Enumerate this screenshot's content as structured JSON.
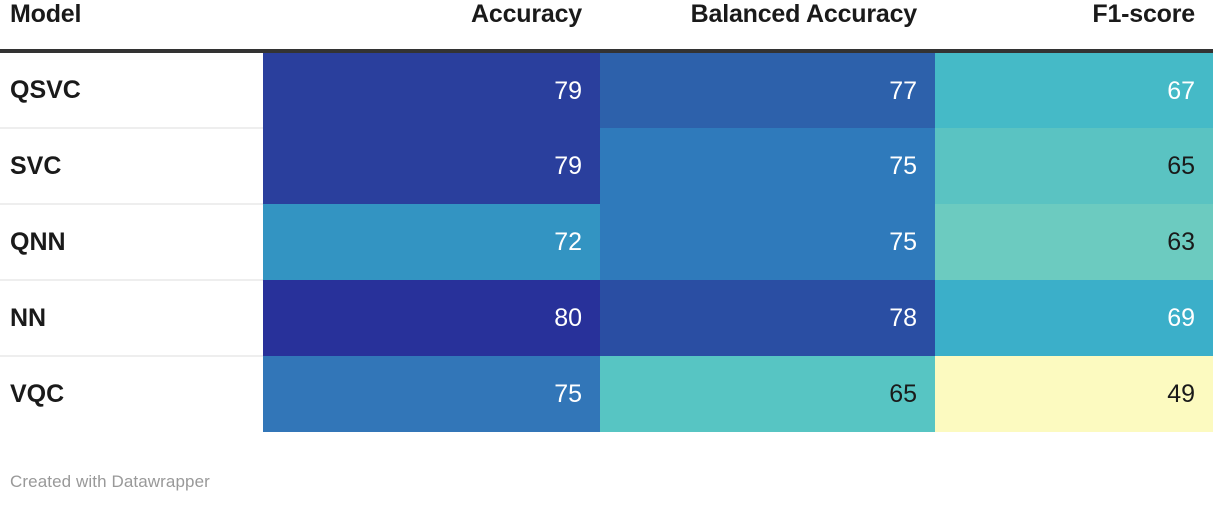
{
  "footer": {
    "credit": "Created with Datawrapper"
  },
  "chart_data": {
    "type": "heatmap",
    "title": "",
    "subtitle": "",
    "xlabel": "",
    "ylabel": "",
    "grid": false,
    "legend": "none",
    "value_suffix": "",
    "columns": [
      "Model",
      "Accuracy",
      "Balanced Accuracy",
      "F1-score"
    ],
    "row_label_header": "Model",
    "categories": [
      "QSVC",
      "SVC",
      "QNN",
      "NN",
      "VQC"
    ],
    "series": [
      {
        "name": "Accuracy",
        "values": [
          79,
          79,
          72,
          80,
          75
        ]
      },
      {
        "name": "Balanced Accuracy",
        "values": [
          77,
          75,
          75,
          78,
          65
        ]
      },
      {
        "name": "F1-score",
        "values": [
          67,
          65,
          63,
          69,
          49
        ]
      }
    ],
    "rows": [
      {
        "model": "QSVC",
        "cells": [
          {
            "column": "Accuracy",
            "value": 79,
            "bg": "#2a3f9d",
            "fg": "#ffffff"
          },
          {
            "column": "Balanced Accuracy",
            "value": 77,
            "bg": "#2d61ab",
            "fg": "#ffffff"
          },
          {
            "column": "F1-score",
            "value": 67,
            "bg": "#45bac7",
            "fg": "#ffffff"
          }
        ]
      },
      {
        "model": "SVC",
        "cells": [
          {
            "column": "Accuracy",
            "value": 79,
            "bg": "#2a3f9d",
            "fg": "#ffffff"
          },
          {
            "column": "Balanced Accuracy",
            "value": 75,
            "bg": "#2f7abb",
            "fg": "#ffffff"
          },
          {
            "column": "F1-score",
            "value": 65,
            "bg": "#5ac3c2",
            "fg": "#1a1a1a"
          }
        ]
      },
      {
        "model": "QNN",
        "cells": [
          {
            "column": "Accuracy",
            "value": 72,
            "bg": "#3394c2",
            "fg": "#ffffff"
          },
          {
            "column": "Balanced Accuracy",
            "value": 75,
            "bg": "#2f7abb",
            "fg": "#ffffff"
          },
          {
            "column": "F1-score",
            "value": 63,
            "bg": "#6ccbc0",
            "fg": "#1a1a1a"
          }
        ]
      },
      {
        "model": "NN",
        "cells": [
          {
            "column": "Accuracy",
            "value": 80,
            "bg": "#28319a",
            "fg": "#ffffff"
          },
          {
            "column": "Balanced Accuracy",
            "value": 78,
            "bg": "#2a4ea3",
            "fg": "#ffffff"
          },
          {
            "column": "F1-score",
            "value": 69,
            "bg": "#3bafc9",
            "fg": "#ffffff"
          }
        ]
      },
      {
        "model": "VQC",
        "cells": [
          {
            "column": "Accuracy",
            "value": 75,
            "bg": "#3276b8",
            "fg": "#ffffff"
          },
          {
            "column": "Balanced Accuracy",
            "value": 65,
            "bg": "#57c5c3",
            "fg": "#1a1a1a"
          },
          {
            "column": "F1-score",
            "value": 49,
            "bg": "#fcfac0",
            "fg": "#1a1a1a"
          }
        ]
      }
    ],
    "color_scale": {
      "low": "#fcfac0",
      "mid": "#45bac7",
      "high": "#28319a",
      "domain": [
        49,
        80
      ]
    }
  }
}
